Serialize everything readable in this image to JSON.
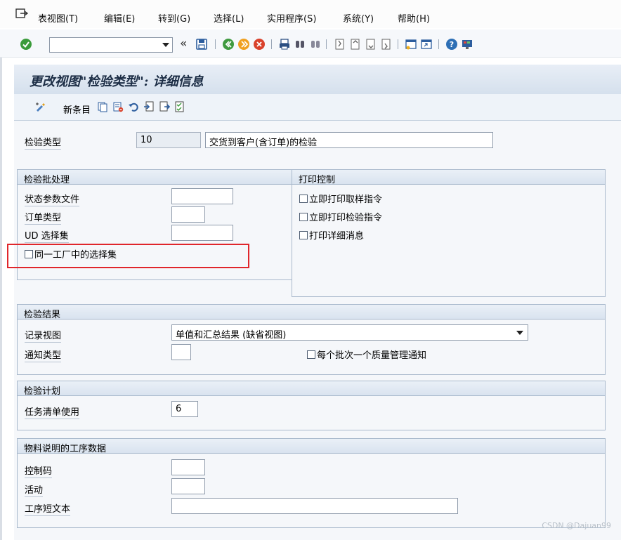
{
  "menu": {
    "items": [
      "表视图(T)",
      "编辑(E)",
      "转到(G)",
      "选择(L)",
      "实用程序(S)",
      "系统(Y)",
      "帮助(H)"
    ]
  },
  "toolbar": {
    "command_value": "",
    "nav_glyph": "«"
  },
  "screen": {
    "title": "更改视图\"检验类型\": 详细信息",
    "new_entries": "新条目"
  },
  "form": {
    "insp_type_label": "检验类型",
    "insp_type_value": "10",
    "insp_type_desc": "交货到客户(含订单)的检验"
  },
  "lot_processing": {
    "title": "检验批处理",
    "status_profile_label": "状态参数文件",
    "status_profile_value": "",
    "order_type_label": "订单类型",
    "order_type_value": "",
    "ud_set_label": "UD 选择集",
    "ud_set_value": "",
    "same_plant_label": "同一工厂中的选择集",
    "same_plant_checked": false
  },
  "print_control": {
    "title": "打印控制",
    "items": [
      "立即打印取样指令",
      "立即打印检验指令",
      "打印详细消息"
    ]
  },
  "results": {
    "title": "检验结果",
    "record_view_label": "记录视图",
    "record_view_value": "单值和汇总结果 (缺省视图)",
    "notif_type_label": "通知类型",
    "notif_type_value": "",
    "one_notif_label": "每个批次一个质量管理通知"
  },
  "plan": {
    "title": "检验计划",
    "task_list_label": "任务清单使用",
    "task_list_value": "6"
  },
  "op_data": {
    "title": "物料说明的工序数据",
    "control_key_label": "控制码",
    "control_key_value": "",
    "activity_label": "活动",
    "activity_value": "",
    "op_text_label": "工序短文本",
    "op_text_value": ""
  },
  "watermark": "CSDN @Dajuan99",
  "colors": {
    "highlight": "#e0262b",
    "group_border": "#a9b9cc",
    "title_text": "#1c2d45"
  }
}
